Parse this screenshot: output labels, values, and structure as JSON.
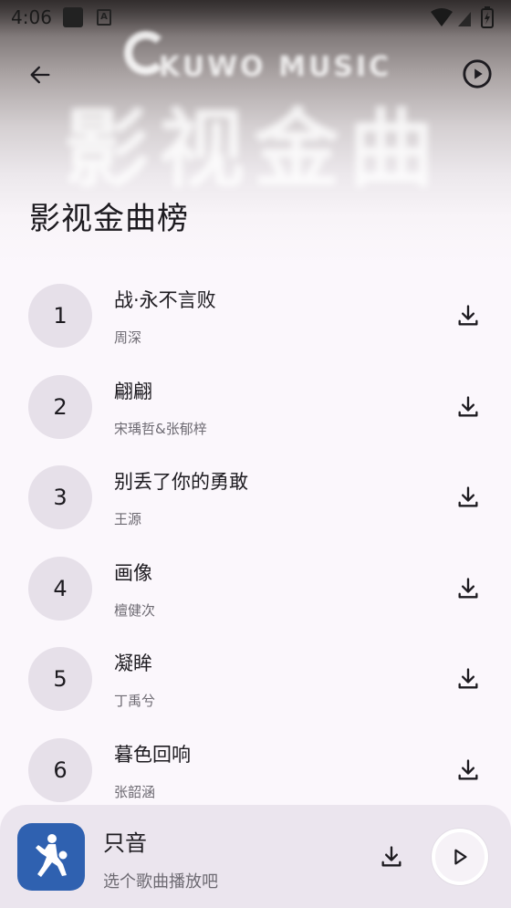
{
  "status_bar": {
    "time": "4:06",
    "sim_icon": "A"
  },
  "header": {
    "hero_logo_text": "KUWO MUSIC",
    "hero_big_text": "影视金曲",
    "title": "影视金曲榜"
  },
  "songs": [
    {
      "rank": "1",
      "title": "战·永不言败",
      "artist": "周深"
    },
    {
      "rank": "2",
      "title": "翩翩",
      "artist": "宋瑀哲&张郁梓"
    },
    {
      "rank": "3",
      "title": "别丢了你的勇敢",
      "artist": "王源"
    },
    {
      "rank": "4",
      "title": "画像",
      "artist": "檀健次"
    },
    {
      "rank": "5",
      "title": "凝眸",
      "artist": "丁禹兮"
    },
    {
      "rank": "6",
      "title": "暮色回响",
      "artist": "张韶涵"
    }
  ],
  "player": {
    "title": "只音",
    "subtitle": "选个歌曲播放吧",
    "cover_color": "#2f61b0"
  },
  "icons": {
    "back": "arrow-back-icon",
    "play_top": "play-circle-icon",
    "download": "download-icon",
    "play": "play-icon"
  }
}
